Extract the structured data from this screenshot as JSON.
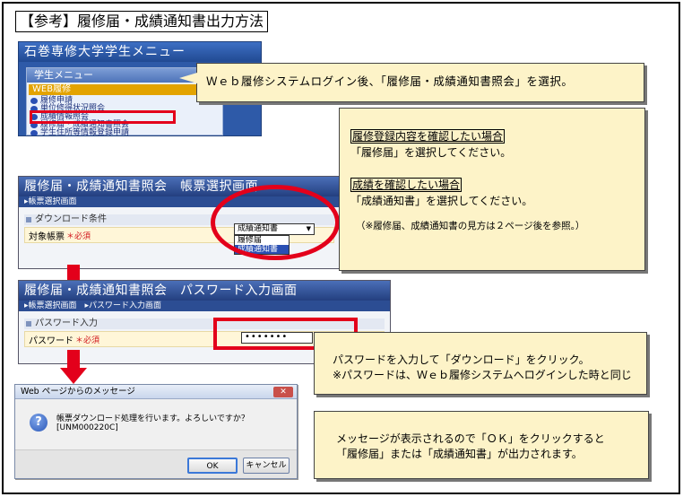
{
  "title": "【参考】履修届・成績通知書出力方法",
  "menu_screen": {
    "title": "石巻専修大学学生メニュー",
    "panel_label": "学生メニュー",
    "section_label": "WEB履修",
    "items": [
      "履修申請",
      "単位修得状況照会",
      "成績情報照会",
      "履修届・成績通知書照会",
      "学生住所等情報登録申請"
    ]
  },
  "callouts": {
    "login": "Ｗｅｂ履修システムログイン後、「履修届・成績通知書照会」を選択。",
    "select": {
      "head1": "履修登録内容を確認したい場合",
      "body1": "「履修届」を選択してください。",
      "head2": "成績を確認したい場合",
      "body2": "「成績通知書」を選択してください。",
      "note": "（※履修届、成績通知書の見方は２ページ後を参照。）"
    },
    "password": {
      "line1": "パスワードを入力して「ダウンロード」をクリック。",
      "line2": "※パスワードは、Ｗｅｂ履修システムへログインした時と同じ"
    },
    "message": {
      "line1": "メッセージが表示されるので「ＯＫ」をクリックすると",
      "line2": "「履修届」または「成績通知書」が出力されます。"
    }
  },
  "select_screen": {
    "title": "履修届・成績通知書照会　帳票選択画面",
    "crumb": "▸帳票選択画面",
    "section": "ダウンロード条件",
    "field_label": "対象帳票",
    "required": "＊必須",
    "selected_value": "成績通知書",
    "dropdown_arrow": "▼",
    "options": [
      "履修届",
      "成績通知書"
    ]
  },
  "password_screen": {
    "title": "履修届・成績通知書照会　パスワード入力画面",
    "crumb": "▸帳票選択画面　▸パスワード入力画面",
    "section": "パスワード入力",
    "field_label": "パスワード",
    "required": "＊必須",
    "password_value": "•••••••"
  },
  "dialog": {
    "title": "Web ページからのメッセージ",
    "close": "✕",
    "message": "帳票ダウンロード処理を行います。よろしいですか？[UNM000220C]",
    "icon": "?",
    "ok": "OK",
    "cancel": "キャンセル"
  },
  "colors": {
    "highlight_red": "#e3001b",
    "callout_bg": "#fdf3c8",
    "screen_blue": "#233f7f"
  }
}
